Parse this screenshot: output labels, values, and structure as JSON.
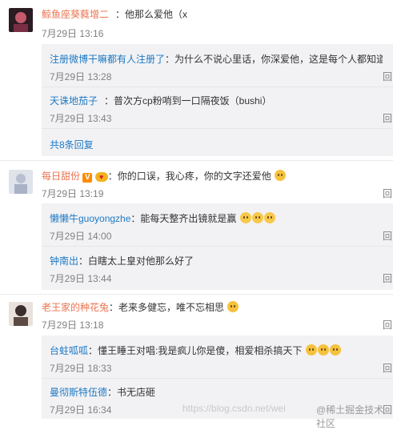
{
  "comments": [
    {
      "user": "鲸鱼座葵蕤增二",
      "text": "：他那么爱他（x",
      "time": "7月29日 13:16",
      "replies": [
        {
          "user": "注册微博干嘛都有人注册了",
          "text": "：为什么不说心里话，你深爱他，这是每个人都知道的",
          "time": "7月29日 13:28",
          "action": "回"
        },
        {
          "user": "天诛地茄子",
          "text": "：普次方cp粉哨到一口隔夜饭（bushi）",
          "time": "7月29日 13:43",
          "action": "回"
        }
      ],
      "more_replies": "共8条回复"
    },
    {
      "user": "每日甜份",
      "badge_v": "V",
      "text": "：你的口误，我心疼，你的文字还爱他",
      "time": "7月29日 13:19",
      "action": "回",
      "replies": [
        {
          "user": "懒懒牛guoyongzhe",
          "text": "：能每天整齐出镜就是赢",
          "time": "7月29日 14:00",
          "action": "回"
        },
        {
          "user": "钟南出",
          "text": "：白瞎太上皇对他那么好了",
          "time": "7月29日 13:44",
          "action": "回"
        }
      ]
    },
    {
      "user": "老王家的种花兔",
      "text": "：老来多健忘，唯不忘相思",
      "time": "7月29日 13:18",
      "action": "回",
      "replies": [
        {
          "user": "台蛀呱呱",
          "text": "：懂王睡王对唱:我是疯儿你是傻，相爱相杀搞天下",
          "time": "7月29日 18:33",
          "action": "回"
        },
        {
          "user": "曼彻斯特伍德",
          "text": "：书无店砸",
          "time": "7月29日 16:34",
          "action": "回"
        }
      ]
    }
  ],
  "watermark": {
    "url": "https://blog.csdn.net/wei",
    "brand": "@稀土掘金技术社区"
  },
  "emoji_names": [
    "doge-icon",
    "grin-icon"
  ],
  "colors": {
    "username": "#eb7350",
    "reply_username": "#1e79c2",
    "reply_bg": "#f2f2f5",
    "time": "#808080"
  }
}
